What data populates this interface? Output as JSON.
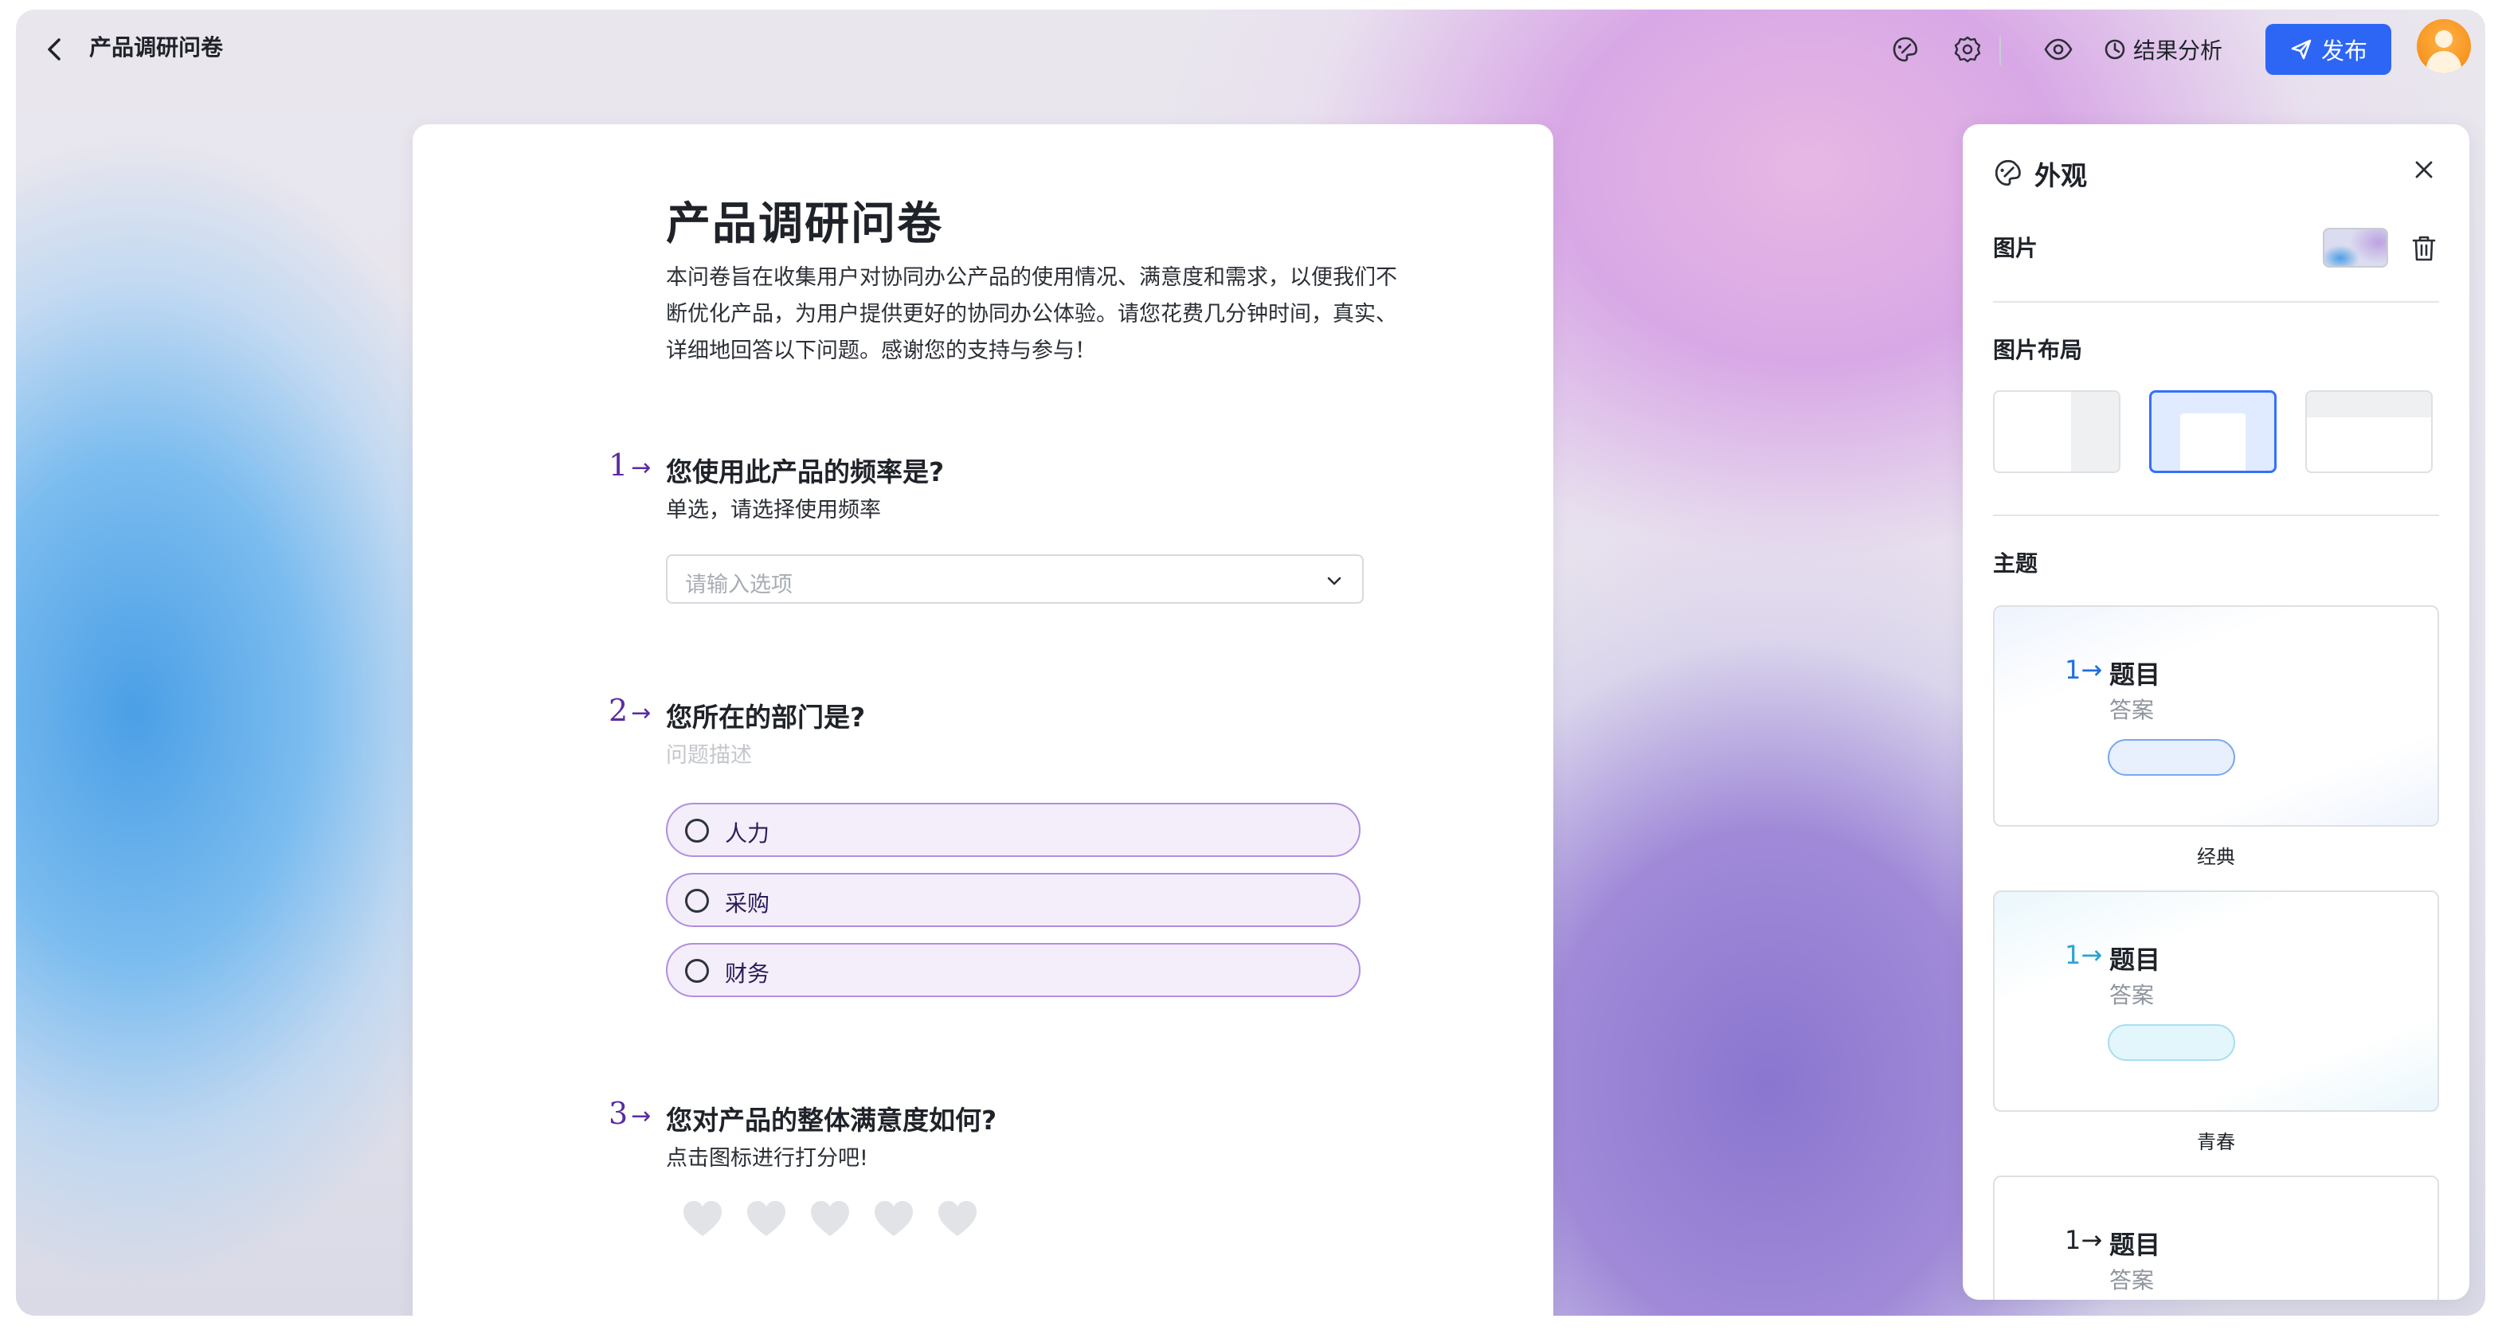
{
  "header": {
    "title": "产品调研问卷",
    "result_label": "结果分析",
    "publish_label": "发布"
  },
  "form": {
    "title": "产品调研问卷",
    "description": "本问卷旨在收集用户对协同办公产品的使用情况、满意度和需求，以便我们不断优化产品，为用户提供更好的协同办公体验。请您花费几分钟时间，真实、详细地回答以下问题。感谢您的支持与参与！",
    "questions": [
      {
        "number": "1",
        "arrow": "→",
        "title": "您使用此产品的频率是?",
        "description": "单选，请选择使用频率",
        "placeholder": "请输入选项"
      },
      {
        "number": "2",
        "arrow": "→",
        "title": "您所在的部门是?",
        "description": "问题描述",
        "options": [
          "人力",
          "采购",
          "财务"
        ]
      },
      {
        "number": "3",
        "arrow": "→",
        "title": "您对产品的整体满意度如何?",
        "description": "点击图标进行打分吧!",
        "rating_max": 5,
        "rating_value": 0
      }
    ]
  },
  "panel": {
    "title": "外观",
    "image_label": "图片",
    "layout_label": "图片布局",
    "layout_selected": 2,
    "theme_label": "主题",
    "themes": [
      {
        "name": "经典",
        "number": "1",
        "arrow": "→",
        "question": "题目",
        "answer": "答案",
        "accent": "#1f6fe0",
        "pill_fill": "#e8f0fd",
        "pill_border": "#7aa7ee"
      },
      {
        "name": "青春",
        "number": "1",
        "arrow": "→",
        "question": "题目",
        "answer": "答案",
        "accent": "#2aa2d6",
        "pill_fill": "#e3f6fc",
        "pill_border": "#a8def0"
      },
      {
        "number": "1",
        "arrow": "→",
        "question": "题目",
        "answer": "答案",
        "accent": "#1f2329"
      }
    ]
  },
  "colors": {
    "primary": "#2d66f5",
    "question_accent": "#5a2ca0",
    "option_border": "#b08ee0",
    "option_fill": "#f4eefb"
  }
}
